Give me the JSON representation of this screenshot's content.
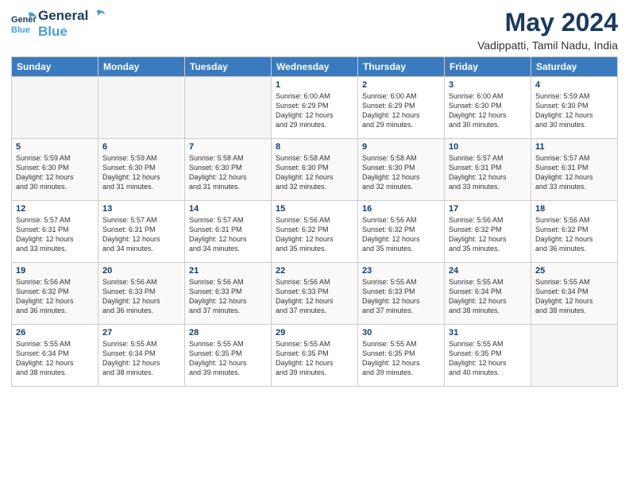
{
  "logo": {
    "general": "General",
    "blue": "Blue"
  },
  "title": "May 2024",
  "subtitle": "Vadippatti, Tamil Nadu, India",
  "headers": [
    "Sunday",
    "Monday",
    "Tuesday",
    "Wednesday",
    "Thursday",
    "Friday",
    "Saturday"
  ],
  "weeks": [
    [
      {
        "day": "",
        "info": ""
      },
      {
        "day": "",
        "info": ""
      },
      {
        "day": "",
        "info": ""
      },
      {
        "day": "1",
        "info": "Sunrise: 6:00 AM\nSunset: 6:29 PM\nDaylight: 12 hours\nand 29 minutes."
      },
      {
        "day": "2",
        "info": "Sunrise: 6:00 AM\nSunset: 6:29 PM\nDaylight: 12 hours\nand 29 minutes."
      },
      {
        "day": "3",
        "info": "Sunrise: 6:00 AM\nSunset: 6:30 PM\nDaylight: 12 hours\nand 30 minutes."
      },
      {
        "day": "4",
        "info": "Sunrise: 5:59 AM\nSunset: 6:30 PM\nDaylight: 12 hours\nand 30 minutes."
      }
    ],
    [
      {
        "day": "5",
        "info": "Sunrise: 5:59 AM\nSunset: 6:30 PM\nDaylight: 12 hours\nand 30 minutes."
      },
      {
        "day": "6",
        "info": "Sunrise: 5:59 AM\nSunset: 6:30 PM\nDaylight: 12 hours\nand 31 minutes."
      },
      {
        "day": "7",
        "info": "Sunrise: 5:58 AM\nSunset: 6:30 PM\nDaylight: 12 hours\nand 31 minutes."
      },
      {
        "day": "8",
        "info": "Sunrise: 5:58 AM\nSunset: 6:30 PM\nDaylight: 12 hours\nand 32 minutes."
      },
      {
        "day": "9",
        "info": "Sunrise: 5:58 AM\nSunset: 6:30 PM\nDaylight: 12 hours\nand 32 minutes."
      },
      {
        "day": "10",
        "info": "Sunrise: 5:57 AM\nSunset: 6:31 PM\nDaylight: 12 hours\nand 33 minutes."
      },
      {
        "day": "11",
        "info": "Sunrise: 5:57 AM\nSunset: 6:31 PM\nDaylight: 12 hours\nand 33 minutes."
      }
    ],
    [
      {
        "day": "12",
        "info": "Sunrise: 5:57 AM\nSunset: 6:31 PM\nDaylight: 12 hours\nand 33 minutes."
      },
      {
        "day": "13",
        "info": "Sunrise: 5:57 AM\nSunset: 6:31 PM\nDaylight: 12 hours\nand 34 minutes."
      },
      {
        "day": "14",
        "info": "Sunrise: 5:57 AM\nSunset: 6:31 PM\nDaylight: 12 hours\nand 34 minutes."
      },
      {
        "day": "15",
        "info": "Sunrise: 5:56 AM\nSunset: 6:32 PM\nDaylight: 12 hours\nand 35 minutes."
      },
      {
        "day": "16",
        "info": "Sunrise: 5:56 AM\nSunset: 6:32 PM\nDaylight: 12 hours\nand 35 minutes."
      },
      {
        "day": "17",
        "info": "Sunrise: 5:56 AM\nSunset: 6:32 PM\nDaylight: 12 hours\nand 35 minutes."
      },
      {
        "day": "18",
        "info": "Sunrise: 5:56 AM\nSunset: 6:32 PM\nDaylight: 12 hours\nand 36 minutes."
      }
    ],
    [
      {
        "day": "19",
        "info": "Sunrise: 5:56 AM\nSunset: 6:32 PM\nDaylight: 12 hours\nand 36 minutes."
      },
      {
        "day": "20",
        "info": "Sunrise: 5:56 AM\nSunset: 6:33 PM\nDaylight: 12 hours\nand 36 minutes."
      },
      {
        "day": "21",
        "info": "Sunrise: 5:56 AM\nSunset: 6:33 PM\nDaylight: 12 hours\nand 37 minutes."
      },
      {
        "day": "22",
        "info": "Sunrise: 5:56 AM\nSunset: 6:33 PM\nDaylight: 12 hours\nand 37 minutes."
      },
      {
        "day": "23",
        "info": "Sunrise: 5:55 AM\nSunset: 6:33 PM\nDaylight: 12 hours\nand 37 minutes."
      },
      {
        "day": "24",
        "info": "Sunrise: 5:55 AM\nSunset: 6:34 PM\nDaylight: 12 hours\nand 38 minutes."
      },
      {
        "day": "25",
        "info": "Sunrise: 5:55 AM\nSunset: 6:34 PM\nDaylight: 12 hours\nand 38 minutes."
      }
    ],
    [
      {
        "day": "26",
        "info": "Sunrise: 5:55 AM\nSunset: 6:34 PM\nDaylight: 12 hours\nand 38 minutes."
      },
      {
        "day": "27",
        "info": "Sunrise: 5:55 AM\nSunset: 6:34 PM\nDaylight: 12 hours\nand 38 minutes."
      },
      {
        "day": "28",
        "info": "Sunrise: 5:55 AM\nSunset: 6:35 PM\nDaylight: 12 hours\nand 39 minutes."
      },
      {
        "day": "29",
        "info": "Sunrise: 5:55 AM\nSunset: 6:35 PM\nDaylight: 12 hours\nand 39 minutes."
      },
      {
        "day": "30",
        "info": "Sunrise: 5:55 AM\nSunset: 6:35 PM\nDaylight: 12 hours\nand 39 minutes."
      },
      {
        "day": "31",
        "info": "Sunrise: 5:55 AM\nSunset: 6:35 PM\nDaylight: 12 hours\nand 40 minutes."
      },
      {
        "day": "",
        "info": ""
      }
    ]
  ],
  "colors": {
    "header_bg": "#3a7bbf",
    "header_text": "#ffffff",
    "title_color": "#1a3a5c",
    "logo_blue": "#4a9fd4"
  }
}
